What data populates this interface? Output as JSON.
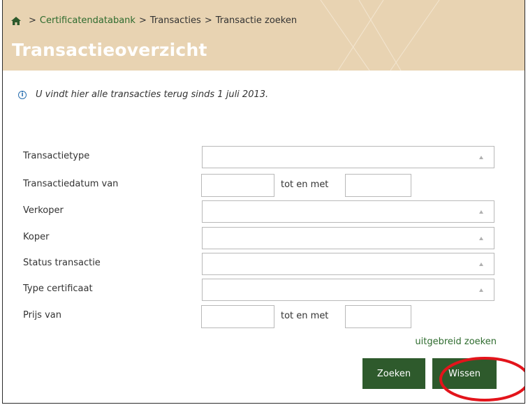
{
  "breadcrumb": {
    "items": [
      "Certificatendatabank",
      "Transacties",
      "Transactie zoeken"
    ],
    "separator": ">"
  },
  "page": {
    "title": "Transactieoverzicht",
    "info": "U vindt hier alle transacties terug sinds 1 juli 2013."
  },
  "form": {
    "transaction_type": {
      "label": "Transactietype",
      "value": ""
    },
    "transaction_date": {
      "label": "Transactiedatum van",
      "between": "tot en met",
      "from": "",
      "to": ""
    },
    "seller": {
      "label": "Verkoper",
      "value": ""
    },
    "buyer": {
      "label": "Koper",
      "value": ""
    },
    "status": {
      "label": "Status transactie",
      "value": ""
    },
    "certificate_type": {
      "label": "Type certificaat",
      "value": ""
    },
    "price": {
      "label": "Prijs van",
      "between": "tot en met",
      "from": "",
      "to": ""
    }
  },
  "actions": {
    "advanced": "uitgebreid zoeken",
    "search": "Zoeken",
    "clear": "Wissen"
  },
  "colors": {
    "header_bg": "#e8d3b2",
    "button_bg": "#2e5a2c",
    "link": "#2e6b2e",
    "highlight": "#e3141b"
  },
  "icons": [
    "home-icon",
    "info-icon",
    "chevron-up-icon"
  ]
}
